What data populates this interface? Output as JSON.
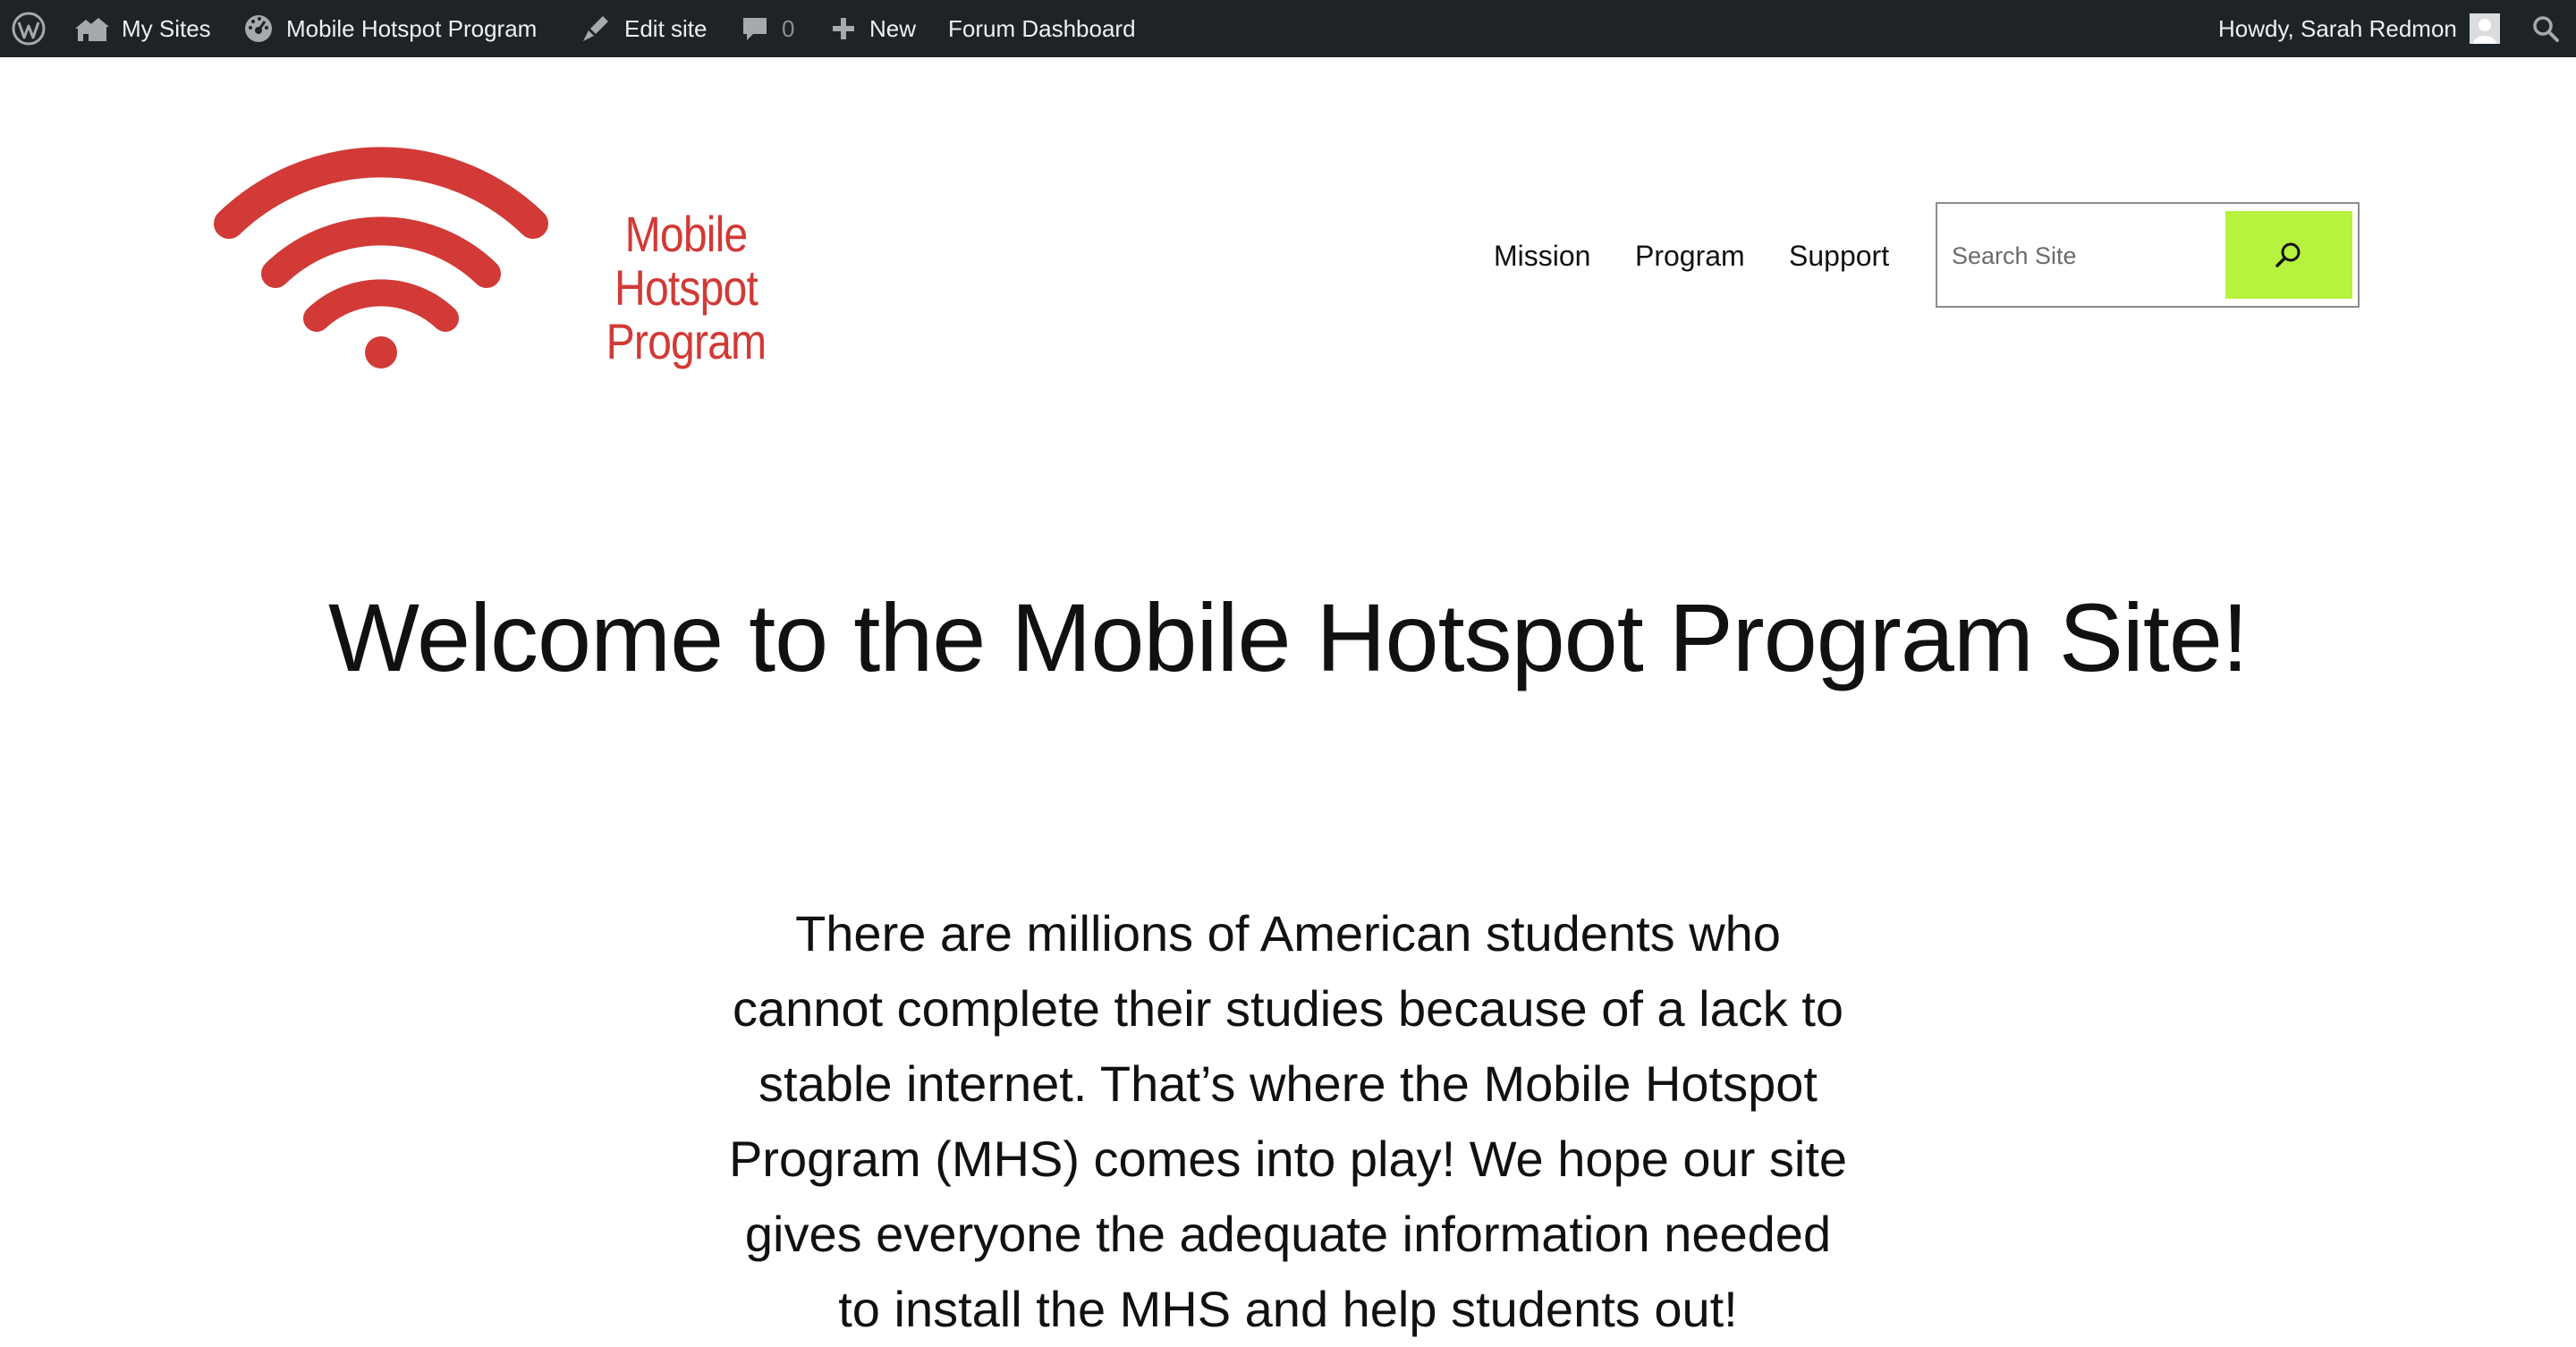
{
  "admin_bar": {
    "items": {
      "wordpress_icon": "wordpress-logo",
      "my_sites": "My Sites",
      "site_name": "Mobile Hotspot Program",
      "edit_site": "Edit site",
      "comments_count": "0",
      "new": "New",
      "forum_dashboard": "Forum Dashboard"
    },
    "greeting": "Howdy, Sarah Redmon"
  },
  "header": {
    "logo_text_line1": "Mobile Hotspot",
    "logo_text_line2": "Program",
    "logo_color": "#d13a36",
    "nav": [
      "Mission",
      "Program",
      "Support"
    ],
    "search": {
      "placeholder": "Search Site",
      "button_color": "#b6f23e"
    }
  },
  "main": {
    "title": "Welcome to the Mobile Hotspot Program Site!",
    "intro_lines": [
      "There are millions of American students who",
      "cannot complete their studies because of a lack to",
      "stable internet. That’s where the Mobile Hotspot",
      "Program (MHS) comes into play! We hope our site",
      "gives everyone the adequate information needed",
      "to install the MHS and help students out!"
    ]
  },
  "colors": {
    "admin_bar_bg": "#1d2327",
    "admin_bar_text": "#f0f0f1",
    "accent_green": "#b6f23e",
    "brand_red": "#d13a36"
  }
}
